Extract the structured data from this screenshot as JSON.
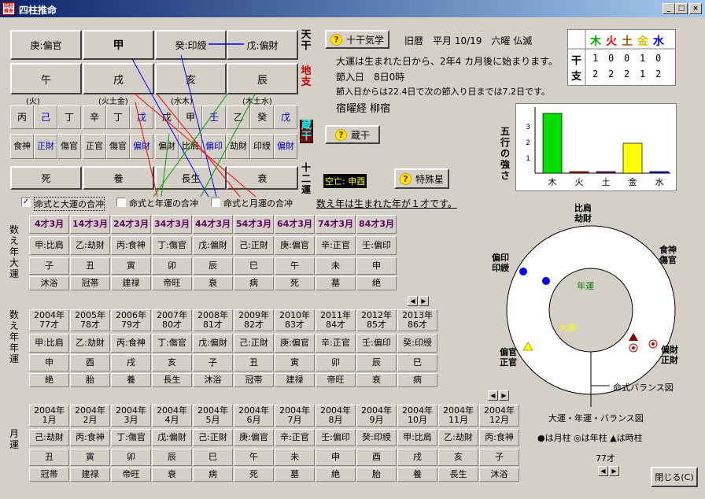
{
  "window": {
    "title": "四柱推命",
    "min": "_",
    "max": "□",
    "close": "×",
    "icon_text": "四柱推命"
  },
  "pillars": {
    "tenkan": [
      {
        "label": "庚:偏官"
      },
      {
        "label": "甲"
      },
      {
        "label": "癸:印綬"
      },
      {
        "label": "戊:偏財"
      }
    ],
    "chishi": [
      "午",
      "戌",
      "亥",
      "辰"
    ],
    "zokan_heads": [
      "(火)",
      "(火土金)",
      "(水木)",
      "(木土水)"
    ],
    "zokan": [
      [
        {
          "t": "丙"
        },
        {
          "t": "己",
          "c": "blue"
        },
        {
          "t": "丁"
        }
      ],
      [
        {
          "t": "辛"
        },
        {
          "t": "丁"
        },
        {
          "t": "戊",
          "c": "blue"
        }
      ],
      [
        {
          "t": "戊"
        },
        {
          "t": "甲"
        },
        {
          "t": "壬",
          "c": "blue"
        }
      ],
      [
        {
          "t": "乙"
        },
        {
          "t": "癸"
        },
        {
          "t": "戊",
          "c": "blue"
        }
      ]
    ],
    "tsuhen": [
      [
        {
          "t": "食神"
        },
        {
          "t": "正財",
          "c": "blue"
        },
        {
          "t": "傷官"
        }
      ],
      [
        {
          "t": "正官"
        },
        {
          "t": "傷官"
        },
        {
          "t": "偏財",
          "c": "blue"
        }
      ],
      [
        {
          "t": "偏財"
        },
        {
          "t": "比肩"
        },
        {
          "t": "偏印",
          "c": "blue"
        }
      ],
      [
        {
          "t": "劫財"
        },
        {
          "t": "印綬"
        },
        {
          "t": "偏財",
          "c": "blue"
        }
      ]
    ],
    "unsei": [
      "死",
      "養",
      "長生",
      "衰"
    ]
  },
  "row_labels": {
    "tenkan": "天干",
    "chishi": "地支",
    "zokan": "蔵干",
    "unsei": "十二運"
  },
  "buttons": {
    "jikkan": "十干気学",
    "zokan": "蔵干",
    "tokushu": "特殊星",
    "close": "閉じる(C)"
  },
  "info": {
    "kyureki": "旧暦　平月 10/19　六曜 仏滅",
    "taiun_start": "大運は生まれた日から、2年4 カ月後に始まります。",
    "setsuiri": "節入日　8日0時",
    "setsuiri_next": "節入日からは22.4日で次の節入り日までは7.2日です。",
    "shukuyo": "宿曜経 柳宿",
    "kubou": "空亡: 申酉",
    "kazoe": "数え年は生まれた年が１才です。"
  },
  "kanshi_table": {
    "elements": [
      {
        "name": "木",
        "color": "#00b000"
      },
      {
        "name": "火",
        "color": "#ff0000"
      },
      {
        "name": "土",
        "color": "#a05000"
      },
      {
        "name": "金",
        "color": "#e0c000"
      },
      {
        "name": "水",
        "color": "#0000ff"
      }
    ],
    "rows": [
      {
        "head": "干",
        "values": [
          "1",
          "0",
          "0",
          "1",
          "0"
        ]
      },
      {
        "head": "支",
        "values": [
          "2",
          "2",
          "2",
          "1",
          "2"
        ]
      }
    ]
  },
  "gogyo_label": "五行の強さ",
  "chart_data": {
    "type": "bar",
    "categories": [
      "木",
      "火",
      "土",
      "金",
      "水"
    ],
    "values": [
      3.8,
      0.1,
      0.1,
      1.9,
      0.1
    ],
    "colors": [
      "#00e000",
      "#c00000",
      "#800080",
      "#ffff00",
      "#0000ff"
    ],
    "ylim": [
      0,
      4
    ],
    "yticks": [
      "1",
      "2",
      "3"
    ],
    "xlabel": "",
    "ylabel": "",
    "title": ""
  },
  "checkboxes": [
    {
      "label": "命式と大運の合冲",
      "checked": "✓"
    },
    {
      "label": "命式と年運の合冲",
      "checked": ""
    },
    {
      "label": "命式と月運の合冲",
      "checked": ""
    }
  ],
  "taiun": {
    "label": "数え年大運",
    "cols": [
      {
        "age": "4才3月",
        "kan": "甲:比肩",
        "shi": "子",
        "un": "沐浴"
      },
      {
        "age": "14才3月",
        "kan": "乙:劫財",
        "shi": "丑",
        "un": "冠帯"
      },
      {
        "age": "24才3月",
        "kan": "丙:食神",
        "shi": "寅",
        "un": "建禄"
      },
      {
        "age": "34才3月",
        "kan": "丁:傷官",
        "shi": "卯",
        "un": "帝旺"
      },
      {
        "age": "44才3月",
        "kan": "戊:偏財",
        "shi": "辰",
        "un": "衰"
      },
      {
        "age": "54才3月",
        "kan": "己:正財",
        "shi": "巳",
        "un": "病"
      },
      {
        "age": "64才3月",
        "kan": "庚:偏官",
        "shi": "午",
        "un": "死"
      },
      {
        "age": "74才3月",
        "kan": "辛:正官",
        "shi": "未",
        "un": "墓"
      },
      {
        "age": "84才3月",
        "kan": "壬:偏印",
        "shi": "申",
        "un": "絶"
      }
    ]
  },
  "nenun": {
    "label": "数え年年運",
    "cols": [
      {
        "y": "2004年",
        "a": "77才",
        "kan": "甲:比肩",
        "shi": "申",
        "un": "絶"
      },
      {
        "y": "2005年",
        "a": "78才",
        "kan": "乙:劫財",
        "shi": "酉",
        "un": "胎"
      },
      {
        "y": "2006年",
        "a": "79才",
        "kan": "丙:食神",
        "shi": "戌",
        "un": "養"
      },
      {
        "y": "2007年",
        "a": "80才",
        "kan": "丁:傷官",
        "shi": "亥",
        "un": "長生"
      },
      {
        "y": "2008年",
        "a": "81才",
        "kan": "戊:偏財",
        "shi": "子",
        "un": "沐浴"
      },
      {
        "y": "2009年",
        "a": "82才",
        "kan": "己:正財",
        "shi": "丑",
        "un": "冠帯"
      },
      {
        "y": "2010年",
        "a": "83才",
        "kan": "庚:偏官",
        "shi": "寅",
        "un": "建禄"
      },
      {
        "y": "2011年",
        "a": "84才",
        "kan": "辛:正官",
        "shi": "卯",
        "un": "帝旺"
      },
      {
        "y": "2012年",
        "a": "85才",
        "kan": "壬:偏印",
        "shi": "辰",
        "un": "衰"
      },
      {
        "y": "2013年",
        "a": "86才",
        "kan": "癸:印綬",
        "shi": "巳",
        "un": "病"
      }
    ]
  },
  "getsuun": {
    "label": "月運",
    "cols": [
      {
        "y": "2004年",
        "m": "1月",
        "kan": "己:劫財",
        "shi": "丑",
        "un": "冠帯"
      },
      {
        "y": "2004年",
        "m": "2月",
        "kan": "丙:食神",
        "shi": "寅",
        "un": "建禄"
      },
      {
        "y": "2004年",
        "m": "3月",
        "kan": "丁:傷官",
        "shi": "卯",
        "un": "帝旺"
      },
      {
        "y": "2004年",
        "m": "4月",
        "kan": "戊:偏財",
        "shi": "辰",
        "un": "衰"
      },
      {
        "y": "2004年",
        "m": "5月",
        "kan": "己:正財",
        "shi": "巳",
        "un": "病"
      },
      {
        "y": "2004年",
        "m": "6月",
        "kan": "庚:偏官",
        "shi": "午",
        "un": "死"
      },
      {
        "y": "2004年",
        "m": "7月",
        "kan": "辛:正官",
        "shi": "未",
        "un": "墓"
      },
      {
        "y": "2004年",
        "m": "8月",
        "kan": "壬:偏印",
        "shi": "申",
        "un": "絶"
      },
      {
        "y": "2004年",
        "m": "9月",
        "kan": "癸:印綬",
        "shi": "酉",
        "un": "胎"
      },
      {
        "y": "2004年",
        "m": "10月",
        "kan": "甲:比肩",
        "shi": "戌",
        "un": "養"
      },
      {
        "y": "2004年",
        "m": "11月",
        "kan": "乙:劫財",
        "shi": "亥",
        "un": "長生"
      },
      {
        "y": "2004年",
        "m": "12月",
        "kan": "丙:食神",
        "shi": "子",
        "un": "沐浴"
      }
    ]
  },
  "balance": {
    "top": "比肩\n劫財",
    "tr": "食神\n傷官",
    "right": "偏財\n正財",
    "left_top": "偏印\n印綬",
    "left_bot": "偏官\n正官",
    "nenun": "年運",
    "taiun": "大運",
    "meishiki_label": "命式バランス図",
    "taiun_label": "大運・年運・バランス図",
    "legend": "●は月柱 ◎は年柱 ▲は時柱",
    "age": "77才"
  }
}
